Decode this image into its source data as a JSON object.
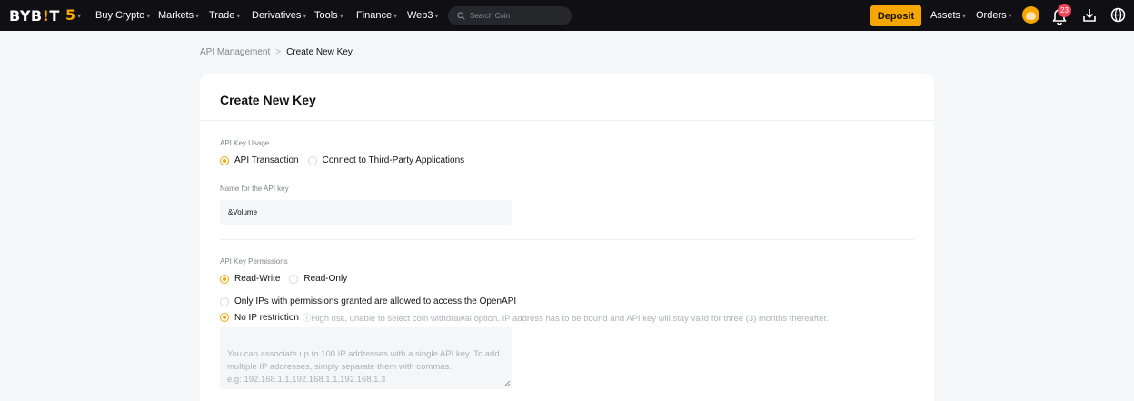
{
  "brand": {
    "logo_text_a": "BYB",
    "logo_text_bar": "!",
    "logo_text_b": "T",
    "five": "5"
  },
  "nav": {
    "items": [
      {
        "label": "Buy Crypto",
        "caret": "▾"
      },
      {
        "label": "Markets",
        "caret": "▾"
      },
      {
        "label": "Trade",
        "caret": "▾"
      },
      {
        "label": "Derivatives",
        "caret": "▾"
      },
      {
        "label": "Tools",
        "caret": "▾"
      },
      {
        "label": "Finance",
        "caret": "▾"
      },
      {
        "label": "Web3",
        "caret": "▾"
      }
    ],
    "search_placeholder": "Search Coin",
    "deposit": "Deposit",
    "assets": "Assets",
    "orders": "Orders",
    "notif_count": "23"
  },
  "breadcrumb": {
    "parent": "API Management",
    "sep": ">",
    "current": "Create New Key"
  },
  "form": {
    "title": "Create New Key",
    "usage_label": "API Key Usage",
    "usage_opt1": "API Transaction",
    "usage_opt2": "Connect to Third-Party Applications",
    "name_label": "Name for the API key",
    "name_value": "&Volume",
    "perm_label": "API Key Permissions",
    "perm_opt1": "Read-Write",
    "perm_opt2": "Read-Only",
    "ip_opt1": "Only IPs with permissions granted are allowed to access the OpenAPI",
    "ip_opt2": "No IP restriction",
    "ip_warning": "ⓘHigh risk, unable to select coin withdrawal option. IP address has to be bound and API key will stay valid for three (3) months thereafter.",
    "ip_placeholder": "You can associate up to 100 IP addresses with a single API key. To add multiple IP addresses, simply separate them with commas.\ne.g: 192.168.1.1,192.168.1.1,192.168.1.3"
  },
  "colors": {
    "accent": "#f7a600",
    "nav_bg": "#101014",
    "badge": "#f6465d"
  }
}
